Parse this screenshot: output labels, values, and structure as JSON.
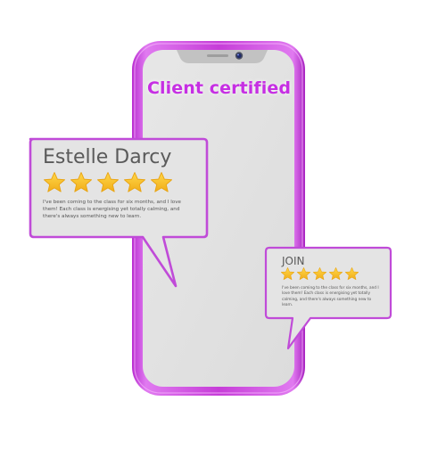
{
  "headline": "Client certified",
  "phone": {
    "frame_color": "#c63dd8",
    "screen_color": "#e2e2e2"
  },
  "reviews": [
    {
      "name": "Estelle Darcy",
      "rating": 5,
      "text": "I've been coming to the class for six months, and I love them! Each class is energising yet totally calming, and there's always something new to learn."
    },
    {
      "name": "JOIN",
      "rating": 5,
      "text": "I've been coming to the class for six months, and I love them! Each class is energising yet totally calming, and there's always something new to learn."
    }
  ],
  "colors": {
    "accent": "#c62fe3",
    "star": "#f7c42c",
    "bubble_border": "#c04bd8",
    "bubble_fill": "#e4e4e4"
  },
  "icons": [
    "front-camera-icon",
    "star-icon"
  ]
}
